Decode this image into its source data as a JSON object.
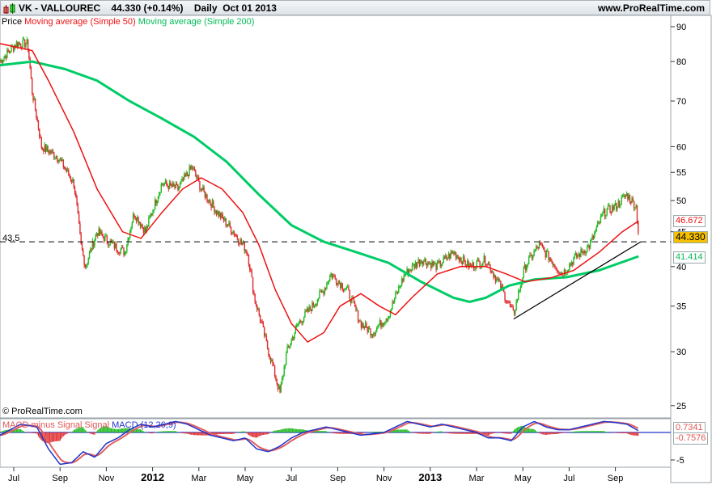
{
  "header": {
    "title": "VK - VALLOUREC",
    "price": "44.330 (+0.14%)",
    "period": "Daily",
    "date": "Oct 01 2013",
    "site": "www.ProRealTime.com"
  },
  "legend": {
    "price": "Price",
    "ma50": "Moving average (Simple 50)",
    "ma200": "Moving average (Simple 200)"
  },
  "copyright": "© ProRealTime.com",
  "macd_legend": {
    "hist": "MACD minus Signal",
    "signal": "Signal",
    "macd": "MACD (12,26,9)"
  },
  "tags": {
    "ma50": "46.672",
    "price": "44.330",
    "ma200": "41.414",
    "macd": "0.7341",
    "hist": "-0.7576",
    "level": "43.5"
  },
  "colors": {
    "up": "#22bb22",
    "down": "#e03030",
    "ma50": "#ee1111",
    "ma200": "#00cc66",
    "macd": "#2233cc",
    "signal": "#e06060",
    "price_tag": "#f5c000"
  },
  "chart_data": {
    "type": "candlestick",
    "x_ticks": [
      {
        "m": 0,
        "label": "Jul"
      },
      {
        "m": 2,
        "label": "Sep"
      },
      {
        "m": 4,
        "label": "Nov"
      },
      {
        "m": 6,
        "label": "2012",
        "bold": true
      },
      {
        "m": 8,
        "label": "Mar"
      },
      {
        "m": 10,
        "label": "May"
      },
      {
        "m": 12,
        "label": "Jul"
      },
      {
        "m": 14,
        "label": "Sep"
      },
      {
        "m": 16,
        "label": "Nov"
      },
      {
        "m": 18,
        "label": "2013",
        "bold": true
      },
      {
        "m": 20,
        "label": "Mar"
      },
      {
        "m": 22,
        "label": "May"
      },
      {
        "m": 24,
        "label": "Jul"
      },
      {
        "m": 26,
        "label": "Sep"
      }
    ],
    "y_ticks": [
      90,
      80,
      70,
      60,
      55,
      50,
      45,
      40,
      35,
      30,
      25
    ],
    "ylim": [
      24,
      93
    ],
    "close": [
      [
        -0.6,
        80
      ],
      [
        0.1,
        85
      ],
      [
        0.6,
        85
      ],
      [
        0.8,
        72
      ],
      [
        1.2,
        60
      ],
      [
        1.9,
        58
      ],
      [
        2.6,
        53
      ],
      [
        2.9,
        43
      ],
      [
        3.1,
        40
      ],
      [
        3.6,
        45
      ],
      [
        4.3,
        43
      ],
      [
        4.8,
        42
      ],
      [
        5.2,
        48
      ],
      [
        5.7,
        45
      ],
      [
        6.4,
        53
      ],
      [
        7.1,
        52
      ],
      [
        7.7,
        56
      ],
      [
        8.1,
        52
      ],
      [
        8.8,
        48
      ],
      [
        9.5,
        45
      ],
      [
        10.1,
        42
      ],
      [
        10.4,
        36
      ],
      [
        10.9,
        31
      ],
      [
        11.5,
        26
      ],
      [
        11.8,
        30
      ],
      [
        12.3,
        33
      ],
      [
        12.9,
        35
      ],
      [
        13.4,
        37
      ],
      [
        13.7,
        39
      ],
      [
        14.4,
        37
      ],
      [
        15.0,
        33
      ],
      [
        15.5,
        32
      ],
      [
        16.2,
        34
      ],
      [
        16.9,
        39
      ],
      [
        17.6,
        41
      ],
      [
        18.3,
        40
      ],
      [
        19.0,
        42
      ],
      [
        19.7,
        40
      ],
      [
        20.4,
        41
      ],
      [
        21.1,
        37
      ],
      [
        21.6,
        34
      ],
      [
        22.1,
        40
      ],
      [
        22.7,
        43
      ],
      [
        23.2,
        41
      ],
      [
        23.7,
        39
      ],
      [
        24.2,
        41
      ],
      [
        24.9,
        43
      ],
      [
        25.5,
        48
      ],
      [
        26.0,
        49
      ],
      [
        26.5,
        51
      ],
      [
        26.9,
        49
      ],
      [
        27.0,
        44.33
      ]
    ],
    "ma50": [
      [
        -0.6,
        85
      ],
      [
        0.8,
        83
      ],
      [
        1.5,
        75
      ],
      [
        2.6,
        63
      ],
      [
        3.6,
        52
      ],
      [
        4.7,
        45
      ],
      [
        5.5,
        44
      ],
      [
        6.4,
        48
      ],
      [
        7.3,
        52
      ],
      [
        8.1,
        54
      ],
      [
        9.0,
        52
      ],
      [
        9.9,
        48
      ],
      [
        10.6,
        43
      ],
      [
        11.3,
        37
      ],
      [
        12.0,
        33
      ],
      [
        12.7,
        31
      ],
      [
        13.4,
        32
      ],
      [
        14.1,
        35
      ],
      [
        15.0,
        36.5
      ],
      [
        15.8,
        35
      ],
      [
        16.5,
        34
      ],
      [
        17.2,
        36
      ],
      [
        18.3,
        39
      ],
      [
        19.3,
        40
      ],
      [
        20.4,
        40
      ],
      [
        21.3,
        39
      ],
      [
        22.1,
        38
      ],
      [
        23.2,
        38.5
      ],
      [
        24.2,
        39.5
      ],
      [
        25.3,
        42
      ],
      [
        26.3,
        45
      ],
      [
        27.0,
        46.67
      ]
    ],
    "ma200": [
      [
        -0.6,
        79
      ],
      [
        0.8,
        80
      ],
      [
        2.2,
        78
      ],
      [
        3.6,
        75
      ],
      [
        5.0,
        70
      ],
      [
        6.4,
        66
      ],
      [
        7.8,
        62
      ],
      [
        9.2,
        57
      ],
      [
        10.6,
        51
      ],
      [
        12.0,
        46
      ],
      [
        13.4,
        43.5
      ],
      [
        14.8,
        42
      ],
      [
        16.2,
        40.5
      ],
      [
        17.6,
        38
      ],
      [
        19.0,
        36
      ],
      [
        19.7,
        35.5
      ],
      [
        20.4,
        36
      ],
      [
        21.4,
        37.5
      ],
      [
        22.5,
        38.3
      ],
      [
        23.9,
        38.6
      ],
      [
        25.3,
        39.5
      ],
      [
        27.0,
        41.41
      ]
    ],
    "trendline": [
      [
        21.6,
        33.5
      ],
      [
        27.1,
        43.5
      ]
    ],
    "hline": 43.5,
    "macd_ticks": [
      {
        "v": -5,
        "label": "-5"
      }
    ],
    "macd": [
      [
        -0.6,
        -0.5
      ],
      [
        0.3,
        1.5
      ],
      [
        1,
        1
      ],
      [
        1.5,
        -3
      ],
      [
        2,
        -5.8
      ],
      [
        2.5,
        -5.5
      ],
      [
        3,
        -3.5
      ],
      [
        3.5,
        -4.5
      ],
      [
        4,
        -2
      ],
      [
        4.5,
        -1
      ],
      [
        5,
        0.5
      ],
      [
        5.5,
        1.5
      ],
      [
        6,
        1
      ],
      [
        6.5,
        1.5
      ],
      [
        7,
        2
      ],
      [
        7.5,
        1.5
      ],
      [
        8,
        0.5
      ],
      [
        8.5,
        -0.5
      ],
      [
        9,
        -1
      ],
      [
        9.5,
        -1.5
      ],
      [
        10,
        -1
      ],
      [
        10.5,
        -3
      ],
      [
        11,
        -3.5
      ],
      [
        11.5,
        -2.5
      ],
      [
        12,
        -1
      ],
      [
        12.5,
        0
      ],
      [
        13,
        0.5
      ],
      [
        13.5,
        1
      ],
      [
        14,
        0.5
      ],
      [
        14.5,
        0
      ],
      [
        15,
        -0.5
      ],
      [
        16,
        0
      ],
      [
        16.5,
        1
      ],
      [
        17,
        2
      ],
      [
        17.5,
        1.5
      ],
      [
        18,
        1
      ],
      [
        18.5,
        1.5
      ],
      [
        19,
        1
      ],
      [
        19.5,
        0.5
      ],
      [
        20,
        0
      ],
      [
        20.5,
        -1
      ],
      [
        21,
        -1
      ],
      [
        21.5,
        -1.5
      ],
      [
        22,
        1
      ],
      [
        22.5,
        2
      ],
      [
        23,
        1
      ],
      [
        23.5,
        0.5
      ],
      [
        24,
        0.5
      ],
      [
        24.5,
        1
      ],
      [
        25,
        1.5
      ],
      [
        25.5,
        2
      ],
      [
        26,
        1.8
      ],
      [
        26.5,
        1.5
      ],
      [
        27,
        0.3
      ]
    ]
  }
}
